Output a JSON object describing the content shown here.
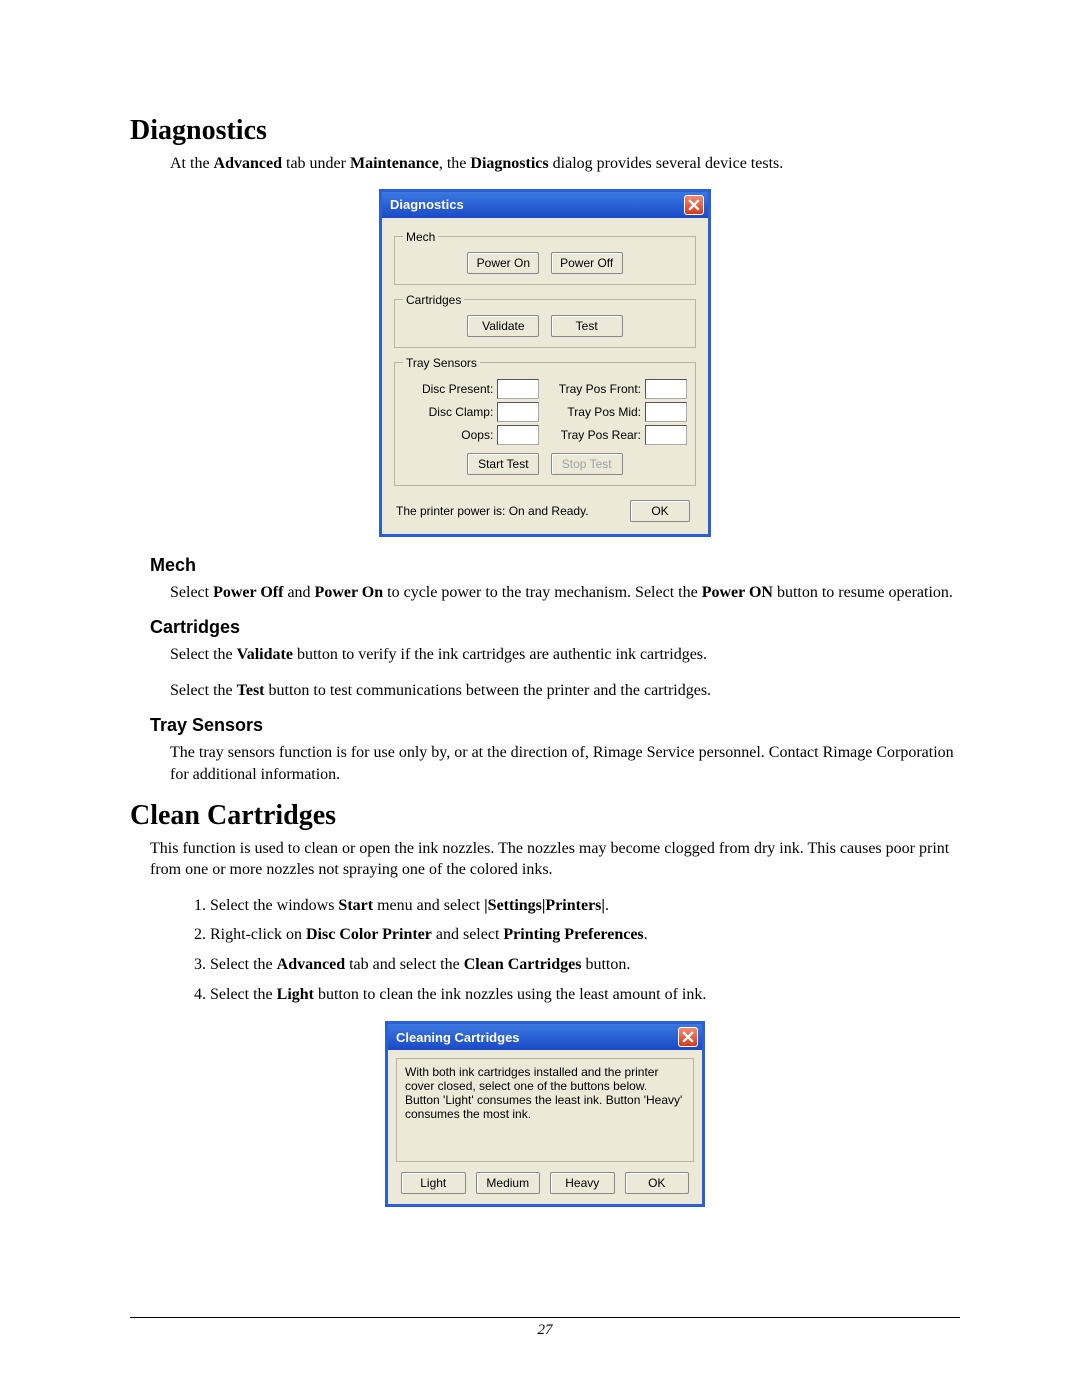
{
  "section1": {
    "heading": "Diagnostics",
    "intro_pre": "At the ",
    "intro_b1": "Advanced",
    "intro_mid1": " tab under ",
    "intro_b2": "Maintenance",
    "intro_mid2": ", the ",
    "intro_b3": "Diagnostics",
    "intro_post": " dialog provides several device tests."
  },
  "diagDialog": {
    "title": "Diagnostics",
    "mech": {
      "legend": "Mech",
      "powerOn": "Power On",
      "powerOff": "Power Off"
    },
    "cartridges": {
      "legend": "Cartridges",
      "validate": "Validate",
      "test": "Test"
    },
    "tray": {
      "legend": "Tray Sensors",
      "discPresent": "Disc Present:",
      "trayFront": "Tray Pos Front:",
      "discClamp": "Disc Clamp:",
      "trayMid": "Tray Pos Mid:",
      "oops": "Oops:",
      "trayRear": "Tray Pos Rear:",
      "startTest": "Start Test",
      "stopTest": "Stop Test"
    },
    "status": "The printer power is: On and Ready.",
    "ok": "OK"
  },
  "mechSection": {
    "heading": "Mech",
    "p_pre": "Select ",
    "p_b1": "Power Off",
    "p_mid1": " and ",
    "p_b2": "Power On",
    "p_mid2": " to cycle power to the tray mechanism. Select the ",
    "p_b3": "Power ON",
    "p_post": " button to resume operation."
  },
  "cartSection": {
    "heading": "Cartridges",
    "p1_pre": "Select the ",
    "p1_b": "Validate",
    "p1_post": " button to verify if the ink cartridges are authentic ink cartridges.",
    "p2_pre": "Select the ",
    "p2_b": "Test",
    "p2_post": " button to test communications between the printer and the cartridges."
  },
  "traySection": {
    "heading": "Tray Sensors",
    "p": "The tray sensors function is for use only by, or at the direction of, Rimage Service personnel. Contact Rimage Corporation for additional information."
  },
  "section2": {
    "heading": "Clean Cartridges",
    "intro": "This function is used to clean or open the ink nozzles. The nozzles may become clogged from dry ink. This causes poor print from one or more nozzles not spraying one of the colored inks.",
    "step1_pre": "Select the windows ",
    "step1_b1": "Start",
    "step1_mid": " menu and select ",
    "step1_b2": "|Settings|Printers|",
    "step1_post": ".",
    "step2_pre": "Right-click on ",
    "step2_b1": "Disc Color Printer",
    "step2_mid": " and select ",
    "step2_b2": "Printing Preferences",
    "step2_post": ".",
    "step3_pre": "Select the ",
    "step3_b1": "Advanced",
    "step3_mid": " tab and select the ",
    "step3_b2": "Clean Cartridges",
    "step3_post": " button.",
    "step4_pre": "Select the ",
    "step4_b1": "Light",
    "step4_post": " button to clean the ink nozzles using the least amount of ink."
  },
  "cleanDialog": {
    "title": "Cleaning Cartridges",
    "text": "   With both ink cartridges installed and the printer cover closed, select one of the buttons below.  Button 'Light' consumes the least ink.  Button 'Heavy' consumes the most ink.",
    "light": "Light",
    "medium": "Medium",
    "heavy": "Heavy",
    "ok": "OK"
  },
  "pageNumber": "27"
}
